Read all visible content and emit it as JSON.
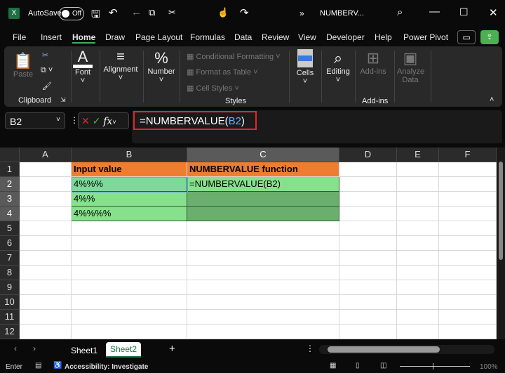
{
  "title": {
    "autosave": "AutoSave",
    "toggle": "Off",
    "filename": "NUMBERV...",
    "more": "»"
  },
  "menu": [
    "File",
    "Insert",
    "Home",
    "Draw",
    "Page Layout",
    "Formulas",
    "Data",
    "Review",
    "View",
    "Developer",
    "Help",
    "Power Pivot"
  ],
  "ribbon": {
    "paste": "Paste",
    "clipboard": "Clipboard",
    "font": "Font",
    "alignment": "Alignment",
    "number": "Number",
    "cond": "Conditional Formatting",
    "table": "Format as Table",
    "styles_btn": "Cell Styles",
    "styles": "Styles",
    "cells": "Cells",
    "editing": "Editing",
    "addins_btn": "Add-ins",
    "addins": "Add-ins",
    "analyze": "Analyze Data"
  },
  "formula_bar": {
    "name_box": "B2",
    "formula_prefix": "=NUMBERVALUE(",
    "formula_ref": "B2",
    "formula_suffix": ")"
  },
  "columns": [
    "A",
    "B",
    "C",
    "D",
    "E",
    "F"
  ],
  "rows": [
    "1",
    "2",
    "3",
    "4",
    "5",
    "6",
    "7",
    "8",
    "9",
    "10",
    "11",
    "12"
  ],
  "cells": {
    "B1": "Input value",
    "C1": "NUMBERVALUE function",
    "B2": "4%%%",
    "C2": "=NUMBERVALUE(B2)",
    "B3": "4%%",
    "B4": "4%%%%"
  },
  "sheets": [
    "Sheet1",
    "Sheet2"
  ],
  "active_sheet": "Sheet2",
  "status": {
    "mode": "Enter",
    "accessibility": "Accessibility: Investigate",
    "zoom": "100%"
  },
  "colors": {
    "header_orange": "#ed7d31",
    "green": "#86e08c",
    "green_dark": "#6aaf6e",
    "accent": "#217346",
    "highlight": "#e0262e"
  }
}
